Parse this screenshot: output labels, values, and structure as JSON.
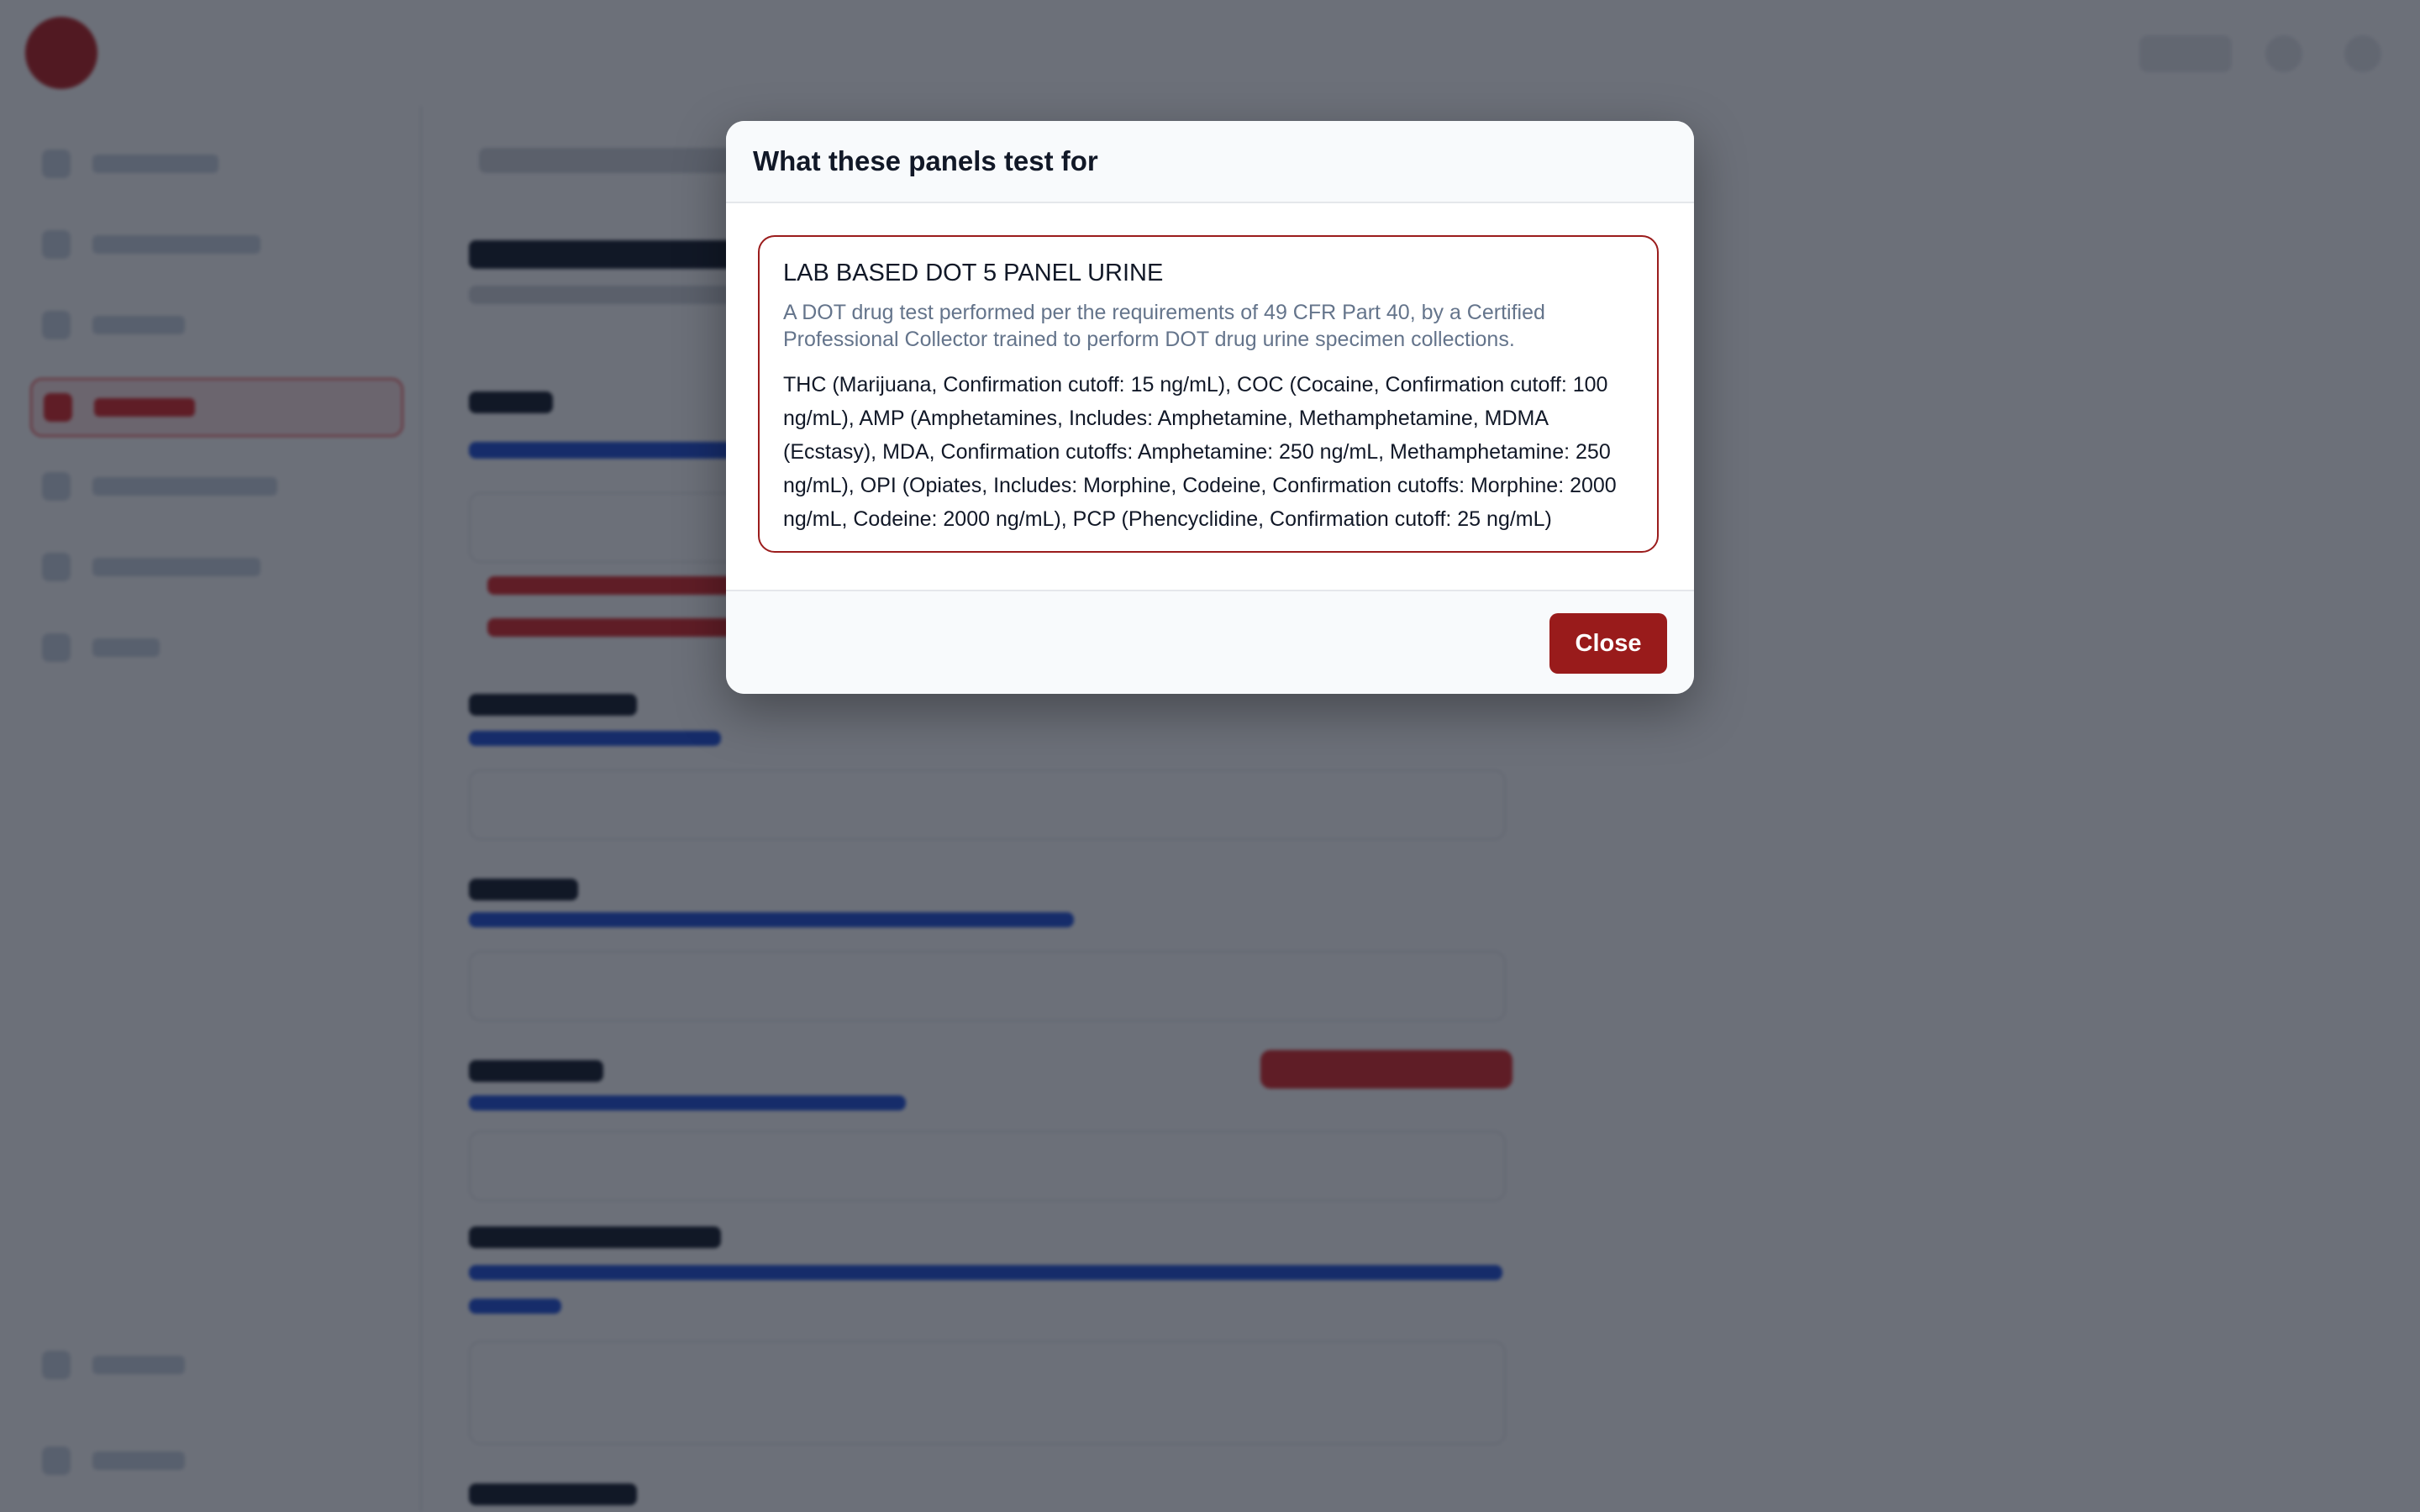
{
  "modal": {
    "title": "What these panels test for",
    "close_label": "Close",
    "panels": [
      {
        "name": "LAB BASED DOT 5 PANEL URINE",
        "description": "A DOT drug test performed per the requirements of 49 CFR Part 40, by a Certified Professional Collector trained to perform DOT drug urine specimen collections.",
        "drugs": "THC (Marijuana, Confirmation cutoff: 15 ng/mL), COC (Cocaine, Confirmation cutoff: 100 ng/mL), AMP (Amphetamines, Includes: Amphetamine, Methamphetamine, MDMA (Ecstasy), MDA, Confirmation cutoffs: Amphetamine: 250 ng/mL, Methamphetamine: 250 ng/mL), OPI (Opiates, Includes: Morphine, Codeine, Confirmation cutoffs: Morphine: 2000 ng/mL, Codeine: 2000 ng/mL), PCP (Phencyclidine, Confirmation cutoff: 25 ng/mL)"
      }
    ]
  },
  "colors": {
    "accent": "#991b1b",
    "overlay": "#111827",
    "panel_border": "#9b1c1c"
  }
}
